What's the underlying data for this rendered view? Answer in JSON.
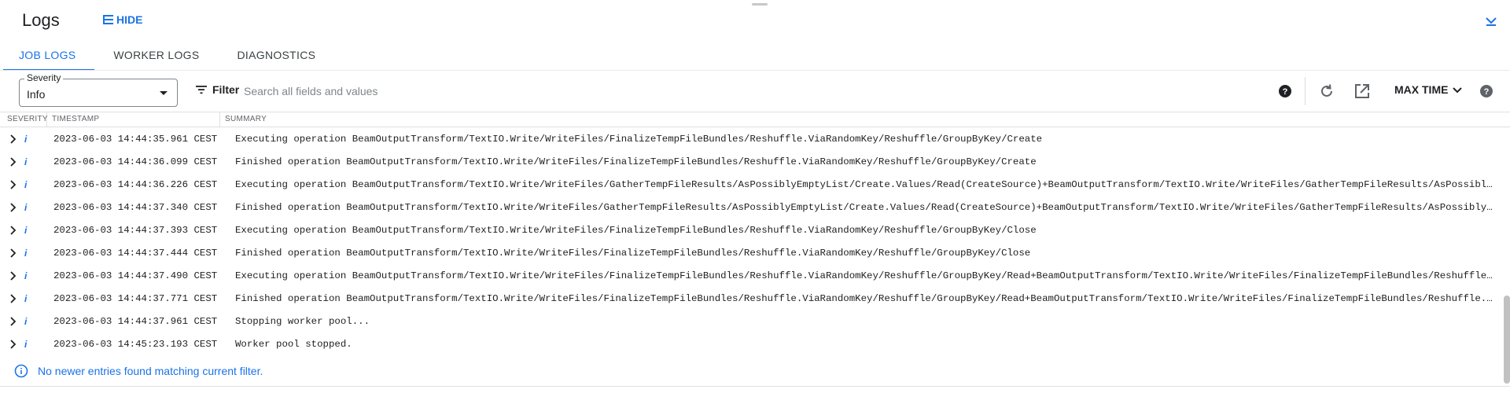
{
  "header": {
    "title": "Logs",
    "hide_label": "HIDE"
  },
  "tabs": [
    {
      "label": "JOB LOGS",
      "active": true
    },
    {
      "label": "WORKER LOGS",
      "active": false
    },
    {
      "label": "DIAGNOSTICS",
      "active": false
    }
  ],
  "toolbar": {
    "severity_label": "Severity",
    "severity_value": "Info",
    "filter_label": "Filter",
    "search_placeholder": "Search all fields and values",
    "max_time_label": "MAX TIME"
  },
  "table": {
    "columns": [
      "SEVERITY",
      "TIMESTAMP",
      "SUMMARY"
    ],
    "rows": [
      {
        "severity": "i",
        "timestamp": "2023-06-03 14:44:35.961 CEST",
        "summary": "Executing operation BeamOutputTransform/TextIO.Write/WriteFiles/FinalizeTempFileBundles/Reshuffle.ViaRandomKey/Reshuffle/GroupByKey/Create"
      },
      {
        "severity": "i",
        "timestamp": "2023-06-03 14:44:36.099 CEST",
        "summary": "Finished operation BeamOutputTransform/TextIO.Write/WriteFiles/FinalizeTempFileBundles/Reshuffle.ViaRandomKey/Reshuffle/GroupByKey/Create"
      },
      {
        "severity": "i",
        "timestamp": "2023-06-03 14:44:36.226 CEST",
        "summary": "Executing operation BeamOutputTransform/TextIO.Write/WriteFiles/GatherTempFileResults/AsPossiblyEmptyList/Create.Values/Read(CreateSource)+BeamOutputTransform/TextIO.Write/WriteFiles/GatherTempFileResults/AsPossiblyEmptyList/Reify.ReifyView..."
      },
      {
        "severity": "i",
        "timestamp": "2023-06-03 14:44:37.340 CEST",
        "summary": "Finished operation BeamOutputTransform/TextIO.Write/WriteFiles/GatherTempFileResults/AsPossiblyEmptyList/Create.Values/Read(CreateSource)+BeamOutputTransform/TextIO.Write/WriteFiles/GatherTempFileResults/AsPossiblyEmptyList/Reify.ReifyView..."
      },
      {
        "severity": "i",
        "timestamp": "2023-06-03 14:44:37.393 CEST",
        "summary": "Executing operation BeamOutputTransform/TextIO.Write/WriteFiles/FinalizeTempFileBundles/Reshuffle.ViaRandomKey/Reshuffle/GroupByKey/Close"
      },
      {
        "severity": "i",
        "timestamp": "2023-06-03 14:44:37.444 CEST",
        "summary": "Finished operation BeamOutputTransform/TextIO.Write/WriteFiles/FinalizeTempFileBundles/Reshuffle.ViaRandomKey/Reshuffle/GroupByKey/Close"
      },
      {
        "severity": "i",
        "timestamp": "2023-06-03 14:44:37.490 CEST",
        "summary": "Executing operation BeamOutputTransform/TextIO.Write/WriteFiles/FinalizeTempFileBundles/Reshuffle.ViaRandomKey/Reshuffle/GroupByKey/Read+BeamOutputTransform/TextIO.Write/WriteFiles/FinalizeTempFileBundles/Reshuffle.ViaRandomKey/Reshuffle/G..."
      },
      {
        "severity": "i",
        "timestamp": "2023-06-03 14:44:37.771 CEST",
        "summary": "Finished operation BeamOutputTransform/TextIO.Write/WriteFiles/FinalizeTempFileBundles/Reshuffle.ViaRandomKey/Reshuffle/GroupByKey/Read+BeamOutputTransform/TextIO.Write/WriteFiles/FinalizeTempFileBundles/Reshuffle.ViaRandomKey/Reshuffle/Gr..."
      },
      {
        "severity": "i",
        "timestamp": "2023-06-03 14:44:37.961 CEST",
        "summary": "Stopping worker pool..."
      },
      {
        "severity": "i",
        "timestamp": "2023-06-03 14:45:23.193 CEST",
        "summary": "Worker pool stopped."
      }
    ]
  },
  "footer": {
    "note": "No newer entries found matching current filter."
  },
  "colors": {
    "accent": "#1a73e8",
    "text": "#202124",
    "muted": "#5f6368"
  }
}
